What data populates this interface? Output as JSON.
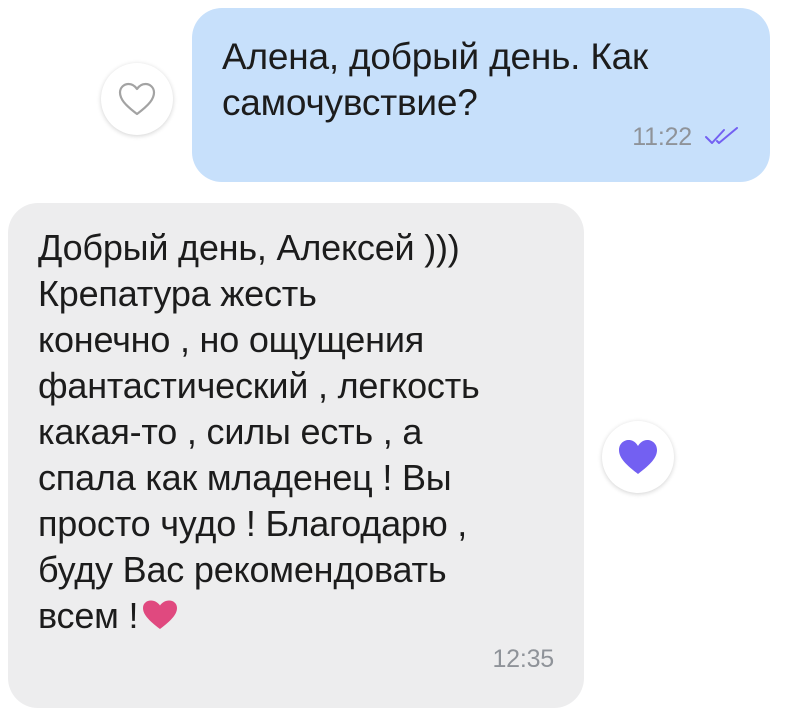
{
  "messages": {
    "outgoing": {
      "text": "Алена, добрый день. Как\nсамочувствие?",
      "time": "11:22",
      "status_icon": "double-check-icon",
      "liked": false
    },
    "incoming": {
      "text": "Добрый день, Алексей )))\nКрепатура жесть\nконечно , но ощущения\nфантастический , легкость\nкакая-то , силы есть , а\nспала как младенец ! Вы\nпросто чудо ! Благодарю ,\nбуду Вас рекомендовать\nвсем !",
      "emoji": "heart-emoji",
      "time": "12:35",
      "liked": true
    }
  },
  "colors": {
    "outgoing_bubble": "#c7e0fb",
    "incoming_bubble": "#ededee",
    "like_active": "#7360f2",
    "like_inactive_outline": "#a3a3a3",
    "read_check": "#7360f2",
    "heart_emoji": "#e0497f",
    "timestamp": "#8f9399"
  }
}
